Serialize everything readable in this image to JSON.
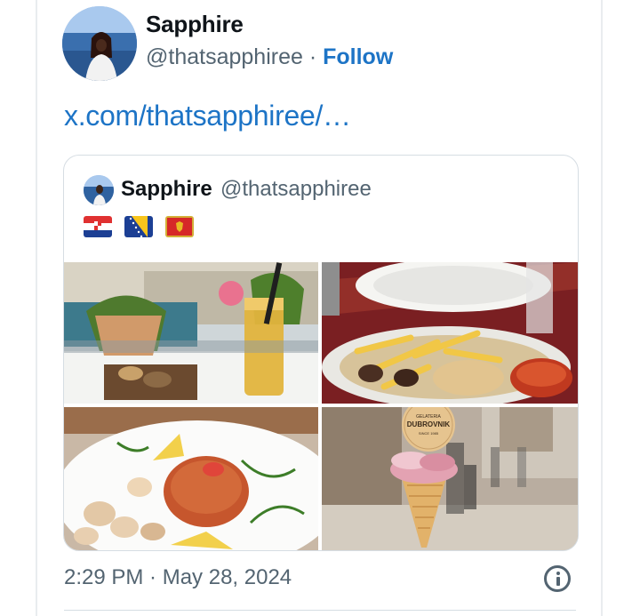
{
  "author": {
    "name": "Sapphire",
    "handle": "@thatsapphiree",
    "separator": "·",
    "follow_label": "Follow"
  },
  "tweet": {
    "link_text": "x.com/thatsapphiree/…",
    "timestamp": "2:29 PM · May 28, 2024"
  },
  "quoted": {
    "name": "Sapphire",
    "handle": "@thatsapphiree",
    "flags": [
      "croatia-flag",
      "bosnia-flag",
      "montenegro-flag"
    ],
    "photos": [
      "cafe-drinks-photo",
      "kebab-fries-photo",
      "risotto-shrimp-photo",
      "dubrovnik-gelato-photo"
    ],
    "gelato_cup_text": "GELATERIA DUBROVNIK"
  },
  "colors": {
    "link": "#1d74c6",
    "secondary_text": "#536471",
    "border": "#d6dde3"
  }
}
